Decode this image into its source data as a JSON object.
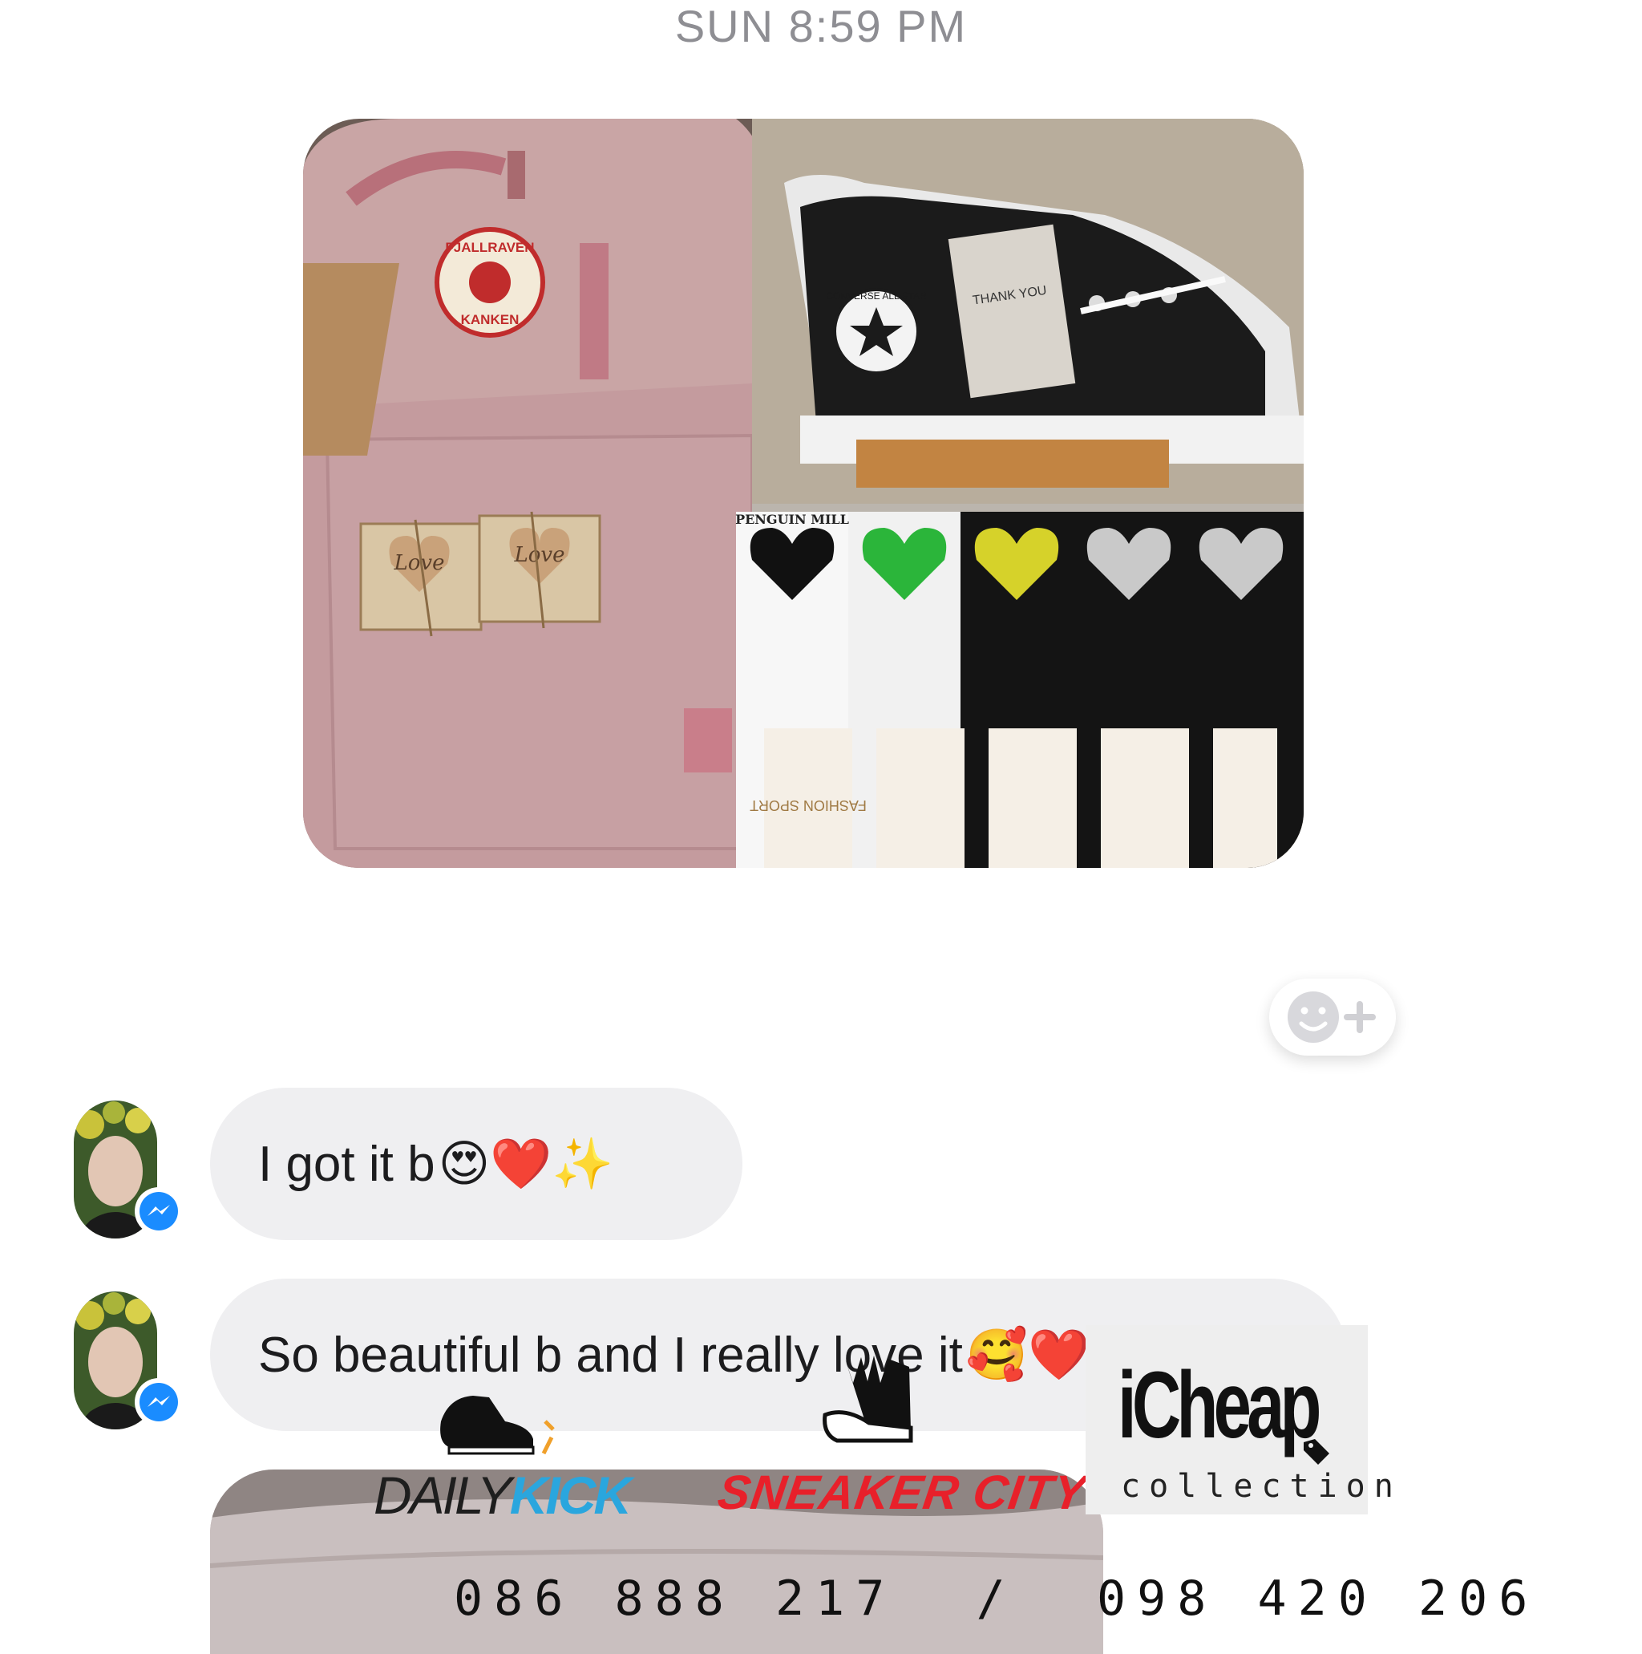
{
  "thread": {
    "timestamp": "SUN 8:59 PM"
  },
  "photo": {
    "backpack_logo_top": "FJALLRAVEN",
    "backpack_logo_bottom": "KANKEN",
    "box_left_text": "Love",
    "box_right_text": "Love",
    "shoe_patch_text": "CONVERSE ALL STAR",
    "card_text": "THANK YOU",
    "sock_brand": "PENGUIN MILL",
    "sock_tag": "FASHION SPORT"
  },
  "messages": [
    {
      "text": "I got it b",
      "emoji": "😍❤️✨"
    },
    {
      "text": "So beautiful b and I really love it",
      "emoji": "🥰❤️✨"
    }
  ],
  "watermark": {
    "daily_part1": "DAILY",
    "daily_part2": "KICK",
    "sneaker_city": "SNEAKER CITY",
    "icheap_name": "iCheap",
    "icheap_sub": "collection",
    "phones": "086 888 217  /  098 420 206"
  },
  "colors": {
    "bubble": "#efeff1",
    "messenger_blue": "#1a8cff",
    "daily_kick_blue": "#2aa6de",
    "sneaker_city_red": "#e8202a"
  },
  "icons": [
    "smiley-plus-icon",
    "messenger-icon",
    "sneaker-logo-icon",
    "price-tag-icon"
  ]
}
